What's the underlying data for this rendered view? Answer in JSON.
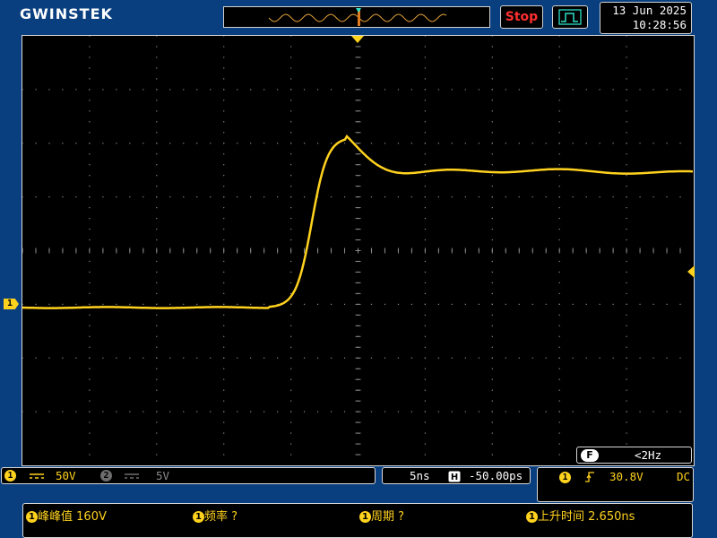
{
  "header": {
    "brand": "GWINSTEK",
    "run_state": "Stop",
    "date": "13 Jun 2025",
    "time": "10:28:56"
  },
  "channel1": {
    "marker": "1",
    "coupling_icon": "dc-coupling-icon",
    "scale": "50V"
  },
  "channel2": {
    "marker": "2",
    "coupling_icon": "dc-coupling-icon",
    "scale": "5V"
  },
  "timebase": {
    "scale": "5ns",
    "position_icon": "h-position-icon",
    "position": "-50.00ps"
  },
  "trigger": {
    "source": "1",
    "slope_icon": "rising-edge-icon",
    "level": "30.8V",
    "coupling": "DC",
    "frequency_badge": "F",
    "frequency": "<2Hz"
  },
  "measurements": [
    {
      "source": "1",
      "label": "峰峰值",
      "value": "160V"
    },
    {
      "source": "1",
      "label": "频率",
      "value": "?"
    },
    {
      "source": "1",
      "label": "周期",
      "value": "?"
    },
    {
      "source": "1",
      "label": "上升时间",
      "value": "2.650ns"
    }
  ],
  "colors": {
    "background": "#0a3f7f",
    "channel1": "#ffd21e",
    "stop": "#ff2f2f",
    "trigger_icon": "#2fe0c8"
  }
}
